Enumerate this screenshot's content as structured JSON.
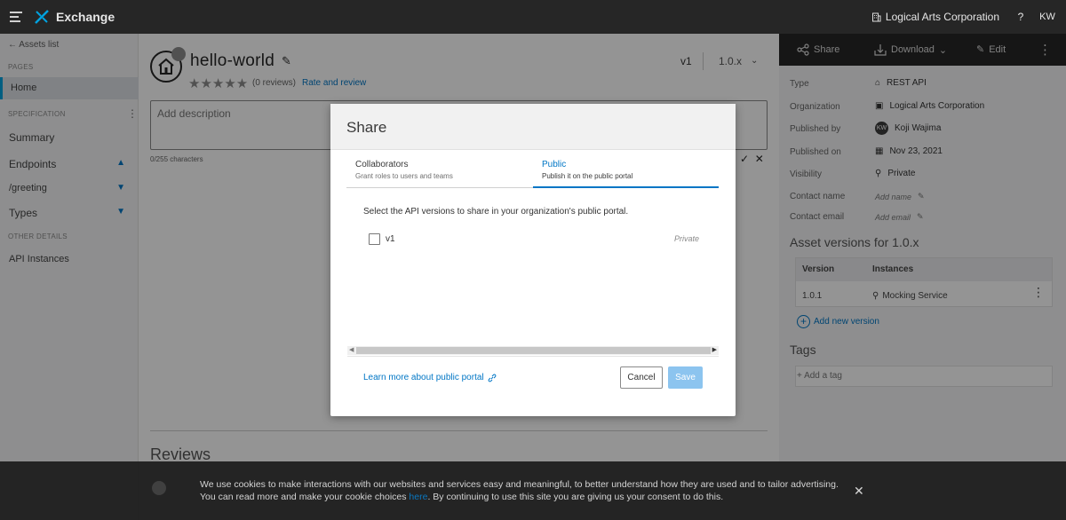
{
  "topbar": {
    "app_title": "Exchange",
    "organization": "Logical Arts Corporation",
    "help": "?",
    "user_initials": "KW"
  },
  "leftnav": {
    "back": "Assets list",
    "pages_section": "PAGES",
    "home": "Home",
    "spec_section": "SPECIFICATION",
    "summary": "Summary",
    "endpoints": "Endpoints",
    "greeting": "/greeting",
    "types": "Types",
    "other_section": "OTHER DETAILS",
    "api_instances": "API Instances"
  },
  "main": {
    "title": "hello-world",
    "reviews_count": "(0 reviews)",
    "rate_link": "Rate and review",
    "version_label": "v1",
    "version_select": "1.0.x",
    "description_placeholder": "Add description",
    "char_count": "0/255 characters",
    "reviews_heading": "Reviews"
  },
  "rightpanel": {
    "share": "Share",
    "download": "Download",
    "edit": "Edit",
    "type_label": "Type",
    "type_value": "REST API",
    "org_label": "Organization",
    "org_value": "Logical Arts Corporation",
    "published_by_label": "Published by",
    "published_by_initials": "KW",
    "published_by_value": "Koji Wajima",
    "published_on_label": "Published on",
    "published_on_value": "Nov 23, 2021",
    "visibility_label": "Visibility",
    "visibility_value": "Private",
    "contact_name_label": "Contact name",
    "contact_name_value": "Add name",
    "contact_email_label": "Contact email",
    "contact_email_value": "Add email",
    "asset_versions_heading": "Asset versions for 1.0.x",
    "col_version": "Version",
    "col_instances": "Instances",
    "row_version": "1.0.1",
    "row_instance": "Mocking Service",
    "add_version": "Add new version",
    "tags_heading": "Tags",
    "add_tag": "Add a tag"
  },
  "modal": {
    "title": "Share",
    "tab_collaborators": "Collaborators",
    "tab_collaborators_sub": "Grant roles to users and teams",
    "tab_public": "Public",
    "tab_public_sub": "Publish it on the public portal",
    "instructions": "Select the API versions to share in your organization's public portal.",
    "version_option": "v1",
    "version_status": "Private",
    "learn_more": "Learn more about public portal",
    "cancel": "Cancel",
    "save": "Save"
  },
  "cookie": {
    "text_before": "We use cookies to make interactions with our websites and services easy and meaningful, to better understand how they are used and to tailor advertising. You can read more and make your cookie choices",
    "link": "here",
    "text_after": ". By continuing to use this site you are giving us your consent to do this."
  },
  "colors": {
    "accent": "#0076c5",
    "topbar": "#262626",
    "save_disabled": "#8cc4ef"
  }
}
